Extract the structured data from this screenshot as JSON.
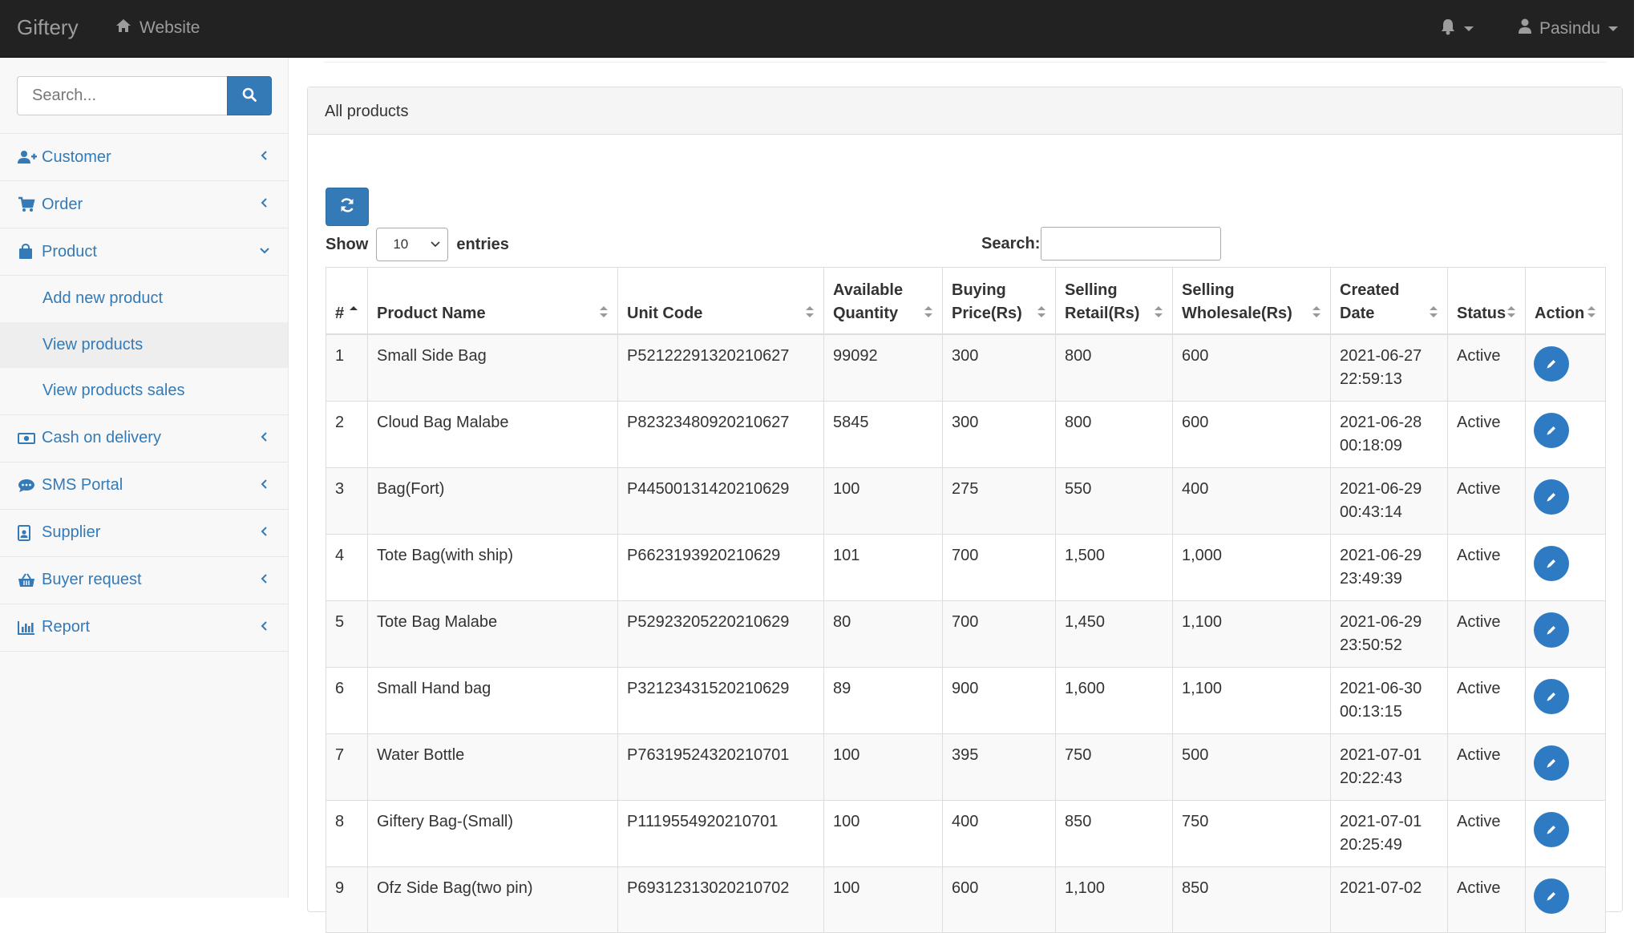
{
  "navbar": {
    "brand": "Giftery",
    "website_link": "Website",
    "user_name": "Pasindu"
  },
  "sidebar": {
    "search_placeholder": "Search...",
    "items": [
      {
        "label": "Customer",
        "icon": "user-plus-icon"
      },
      {
        "label": "Order",
        "icon": "cart-icon"
      },
      {
        "label": "Product",
        "icon": "shopping-bag-icon",
        "expanded": true,
        "children": [
          {
            "label": "Add new product",
            "active": false
          },
          {
            "label": "View products",
            "active": true
          },
          {
            "label": "View products sales",
            "active": false
          }
        ]
      },
      {
        "label": "Cash on delivery",
        "icon": "money-icon"
      },
      {
        "label": "SMS Portal",
        "icon": "comment-icon"
      },
      {
        "label": "Supplier",
        "icon": "id-badge-icon"
      },
      {
        "label": "Buyer request",
        "icon": "basket-icon"
      },
      {
        "label": "Report",
        "icon": "bar-chart-icon"
      }
    ]
  },
  "panel": {
    "title": "All products"
  },
  "table_controls": {
    "show_label": "Show",
    "page_length": "10",
    "entries_label": "entries",
    "search_label": "Search:",
    "search_value": ""
  },
  "table": {
    "columns": [
      {
        "label": "#",
        "sort": "asc"
      },
      {
        "label": "Product Name"
      },
      {
        "label": "Unit Code"
      },
      {
        "label": "Available Quantity"
      },
      {
        "label": "Buying Price(Rs)"
      },
      {
        "label": "Selling Retail(Rs)"
      },
      {
        "label": "Selling Wholesale(Rs)"
      },
      {
        "label": "Created Date"
      },
      {
        "label": "Status"
      },
      {
        "label": "Action"
      }
    ],
    "rows": [
      {
        "num": "1",
        "name": "Small Side Bag",
        "code": "P52122291320210627",
        "qty": "99092",
        "buy": "300",
        "retail": "800",
        "wholesale": "600",
        "date": "2021-06-27",
        "time": "22:59:13",
        "status": "Active"
      },
      {
        "num": "2",
        "name": "Cloud Bag Malabe",
        "code": "P82323480920210627",
        "qty": "5845",
        "buy": "300",
        "retail": "800",
        "wholesale": "600",
        "date": "2021-06-28",
        "time": "00:18:09",
        "status": "Active"
      },
      {
        "num": "3",
        "name": "Bag(Fort)",
        "code": "P44500131420210629",
        "qty": "100",
        "buy": "275",
        "retail": "550",
        "wholesale": "400",
        "date": "2021-06-29",
        "time": "00:43:14",
        "status": "Active"
      },
      {
        "num": "4",
        "name": "Tote Bag(with ship)",
        "code": "P6623193920210629",
        "qty": "101",
        "buy": "700",
        "retail": "1,500",
        "wholesale": "1,000",
        "date": "2021-06-29",
        "time": "23:49:39",
        "status": "Active"
      },
      {
        "num": "5",
        "name": "Tote Bag Malabe",
        "code": "P52923205220210629",
        "qty": "80",
        "buy": "700",
        "retail": "1,450",
        "wholesale": "1,100",
        "date": "2021-06-29",
        "time": "23:50:52",
        "status": "Active"
      },
      {
        "num": "6",
        "name": "Small Hand bag",
        "code": "P32123431520210629",
        "qty": "89",
        "buy": "900",
        "retail": "1,600",
        "wholesale": "1,100",
        "date": "2021-06-30",
        "time": "00:13:15",
        "status": "Active"
      },
      {
        "num": "7",
        "name": "Water Bottle",
        "code": "P76319524320210701",
        "qty": "100",
        "buy": "395",
        "retail": "750",
        "wholesale": "500",
        "date": "2021-07-01",
        "time": "20:22:43",
        "status": "Active"
      },
      {
        "num": "8",
        "name": "Giftery Bag-(Small)",
        "code": "P1119554920210701",
        "qty": "100",
        "buy": "400",
        "retail": "850",
        "wholesale": "750",
        "date": "2021-07-01",
        "time": "20:25:49",
        "status": "Active"
      },
      {
        "num": "9",
        "name": "Ofz Side Bag(two pin)",
        "code": "P69312313020210702",
        "qty": "100",
        "buy": "600",
        "retail": "1,100",
        "wholesale": "850",
        "date": "2021-07-02",
        "time": "",
        "status": "Active"
      }
    ]
  },
  "colors": {
    "navbar_bg": "#222222",
    "link": "#337ab7",
    "primary_button": "#337ab7",
    "edit_button": "#2e7bc4"
  }
}
